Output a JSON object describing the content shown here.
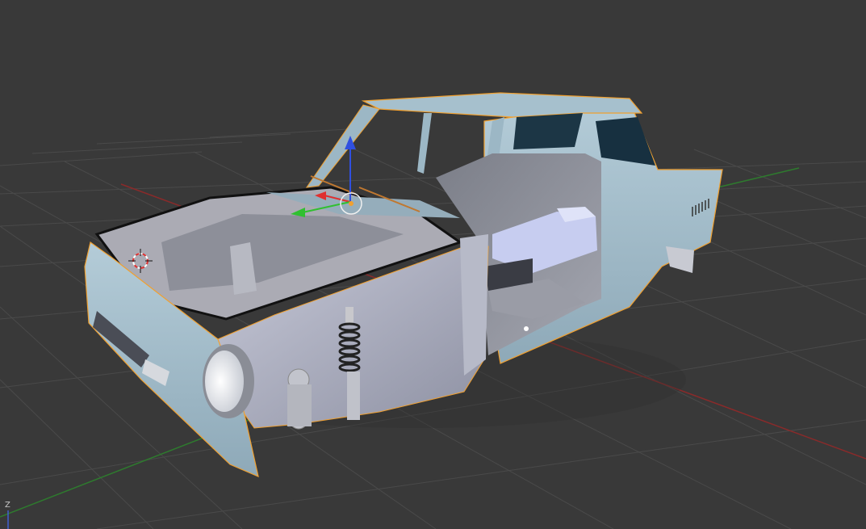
{
  "viewport": {
    "background_color": "#393939",
    "grid_color": "#4a4a4a",
    "x_axis_color": "#8a2a2a",
    "y_axis_color": "#2e7a2e",
    "nav_axis_label": "Z"
  },
  "object": {
    "selection_outline_color": "#f0a030",
    "body_color": "#a8c2cf"
  },
  "gizmo": {
    "x_arrow_color": "#e03030",
    "y_arrow_color": "#30c030",
    "z_arrow_color": "#3050e0"
  },
  "cursor": {
    "color_a": "#e03030",
    "color_b": "#ffffff"
  }
}
